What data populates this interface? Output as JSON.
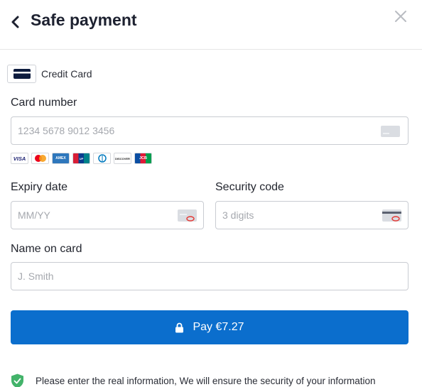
{
  "header": {
    "title": "Safe payment",
    "back_icon": "chevron-left-icon",
    "close_icon": "close-icon"
  },
  "payment_method": {
    "label": "Credit Card",
    "icon": "credit-card-icon"
  },
  "card_number": {
    "label": "Card number",
    "placeholder": "1234 5678 9012 3456",
    "icon": "card-icon"
  },
  "card_brands": [
    "VISA",
    "Mastercard",
    "American Express",
    "UnionPay",
    "Diners Club",
    "Discover",
    "JCB"
  ],
  "expiry": {
    "label": "Expiry date",
    "placeholder": "MM/YY",
    "icon": "card-front-icon"
  },
  "security": {
    "label": "Security code",
    "placeholder": "3 digits",
    "icon": "card-back-cvv-icon"
  },
  "name": {
    "label": "Name on card",
    "placeholder": "J. Smith"
  },
  "pay_button": {
    "label": "Pay €7.27",
    "icon": "lock-icon"
  },
  "notice": {
    "text": "Please enter the real information, We will ensure the security of your information",
    "icon": "shield-check-icon"
  },
  "colors": {
    "primary": "#0b6ecd",
    "border": "#c9ccd2",
    "shield": "#43b36a"
  }
}
